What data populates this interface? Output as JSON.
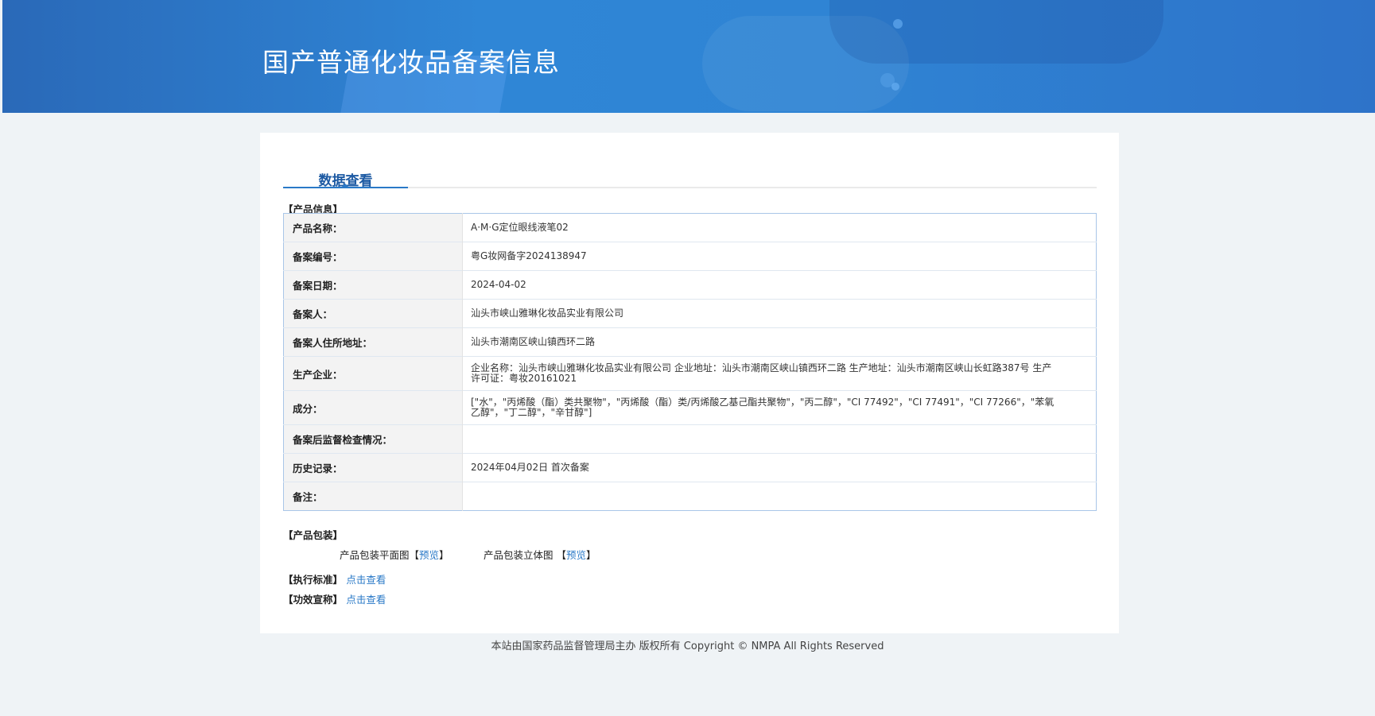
{
  "header": {
    "title": "国产普通化妆品备案信息"
  },
  "tabs": [
    {
      "label": "数据查看"
    }
  ],
  "product_info": {
    "section_label": "【产品信息】",
    "rows": [
      {
        "label": "产品名称：",
        "value": "A·M·G定位眼线液笔02"
      },
      {
        "label": "备案编号：",
        "value": "粤G妆网备字2024138947"
      },
      {
        "label": "备案日期：",
        "value": "2024-04-02"
      },
      {
        "label": "备案人：",
        "value": "汕头市峡山雅琳化妆品实业有限公司"
      },
      {
        "label": "备案人住所地址：",
        "value": "汕头市潮南区峡山镇西环二路"
      },
      {
        "label": "生产企业：",
        "value": "企业名称：汕头市峡山雅琳化妆品实业有限公司 企业地址：汕头市潮南区峡山镇西环二路 生产地址：汕头市潮南区峡山长虹路387号 生产许可证：粤妆20161021"
      },
      {
        "label": "成分：",
        "value": "[\"水\"，\"丙烯酸（酯）类共聚物\"，\"丙烯酸（酯）类/丙烯酸乙基己酯共聚物\"，\"丙二醇\"，\"CI 77492\"，\"CI 77491\"，\"CI 77266\"，\"苯氧乙醇\"，\"丁二醇\"，\"辛甘醇\"]"
      },
      {
        "label": "备案后监督检查情况：",
        "value": ""
      },
      {
        "label": "历史记录：",
        "value": "2024年04月02日 首次备案"
      },
      {
        "label": "备注：",
        "value": ""
      }
    ]
  },
  "packaging": {
    "section_label": "【产品包装】",
    "flat_label": "产品包装平面图",
    "flat_link": "预览",
    "solid_label": "产品包装立体图",
    "solid_link": "预览",
    "bracket_open": "【",
    "bracket_close": "】"
  },
  "standard": {
    "label": "【执行标准】",
    "link": "点击查看"
  },
  "efficacy": {
    "label": "【功效宣称】",
    "link": "点击查看"
  },
  "footer": {
    "text": "本站由国家药品监督管理局主办 版权所有 Copyright © NMPA All Rights Reserved"
  },
  "colors": {
    "banner": "#2f86d6",
    "accent": "#2a79c7",
    "table_border": "#a9c6e8",
    "page_bg": "#eff3f6"
  }
}
